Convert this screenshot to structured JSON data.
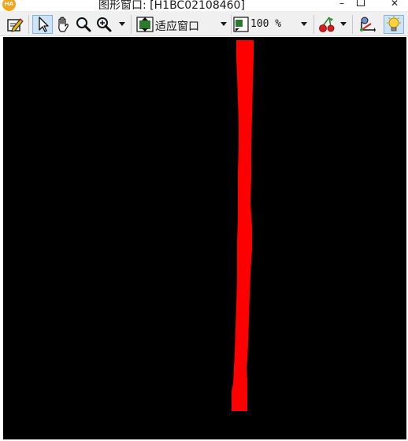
{
  "window": {
    "app_icon_text": "HA",
    "title": "图形窗口: [H1BC02108460]",
    "minimize_glyph": "–",
    "close_glyph": "✕"
  },
  "toolbar": {
    "buttons": [
      {
        "name": "edit-pencil-icon",
        "active": false
      },
      {
        "name": "pointer-select-icon",
        "active": true
      },
      {
        "name": "pan-hand-icon",
        "active": false
      },
      {
        "name": "magnifier-icon",
        "active": false
      },
      {
        "name": "zoom-in-icon",
        "active": false
      },
      {
        "name": "fit-window-icon",
        "active": false
      },
      {
        "name": "zoom-percent-icon",
        "active": false
      },
      {
        "name": "color-cherry-icon",
        "active": false
      },
      {
        "name": "axis-icon",
        "active": false
      },
      {
        "name": "lightbulb-icon",
        "active": true
      }
    ],
    "fit_mode_value": "适应窗口",
    "zoom_value": "100 %"
  },
  "canvas": {
    "background": "#000000",
    "region_color": "#ff0000"
  }
}
